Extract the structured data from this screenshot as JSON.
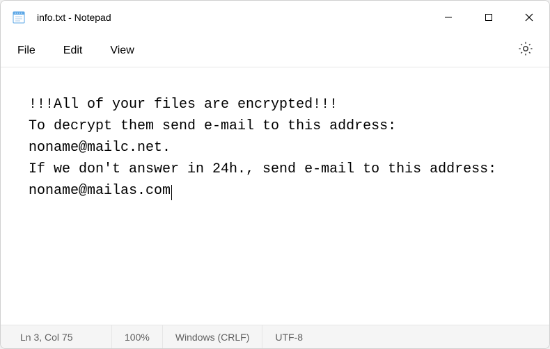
{
  "titlebar": {
    "title": "info.txt - Notepad"
  },
  "menu": {
    "file": "File",
    "edit": "Edit",
    "view": "View"
  },
  "editor": {
    "content": "!!!All of your files are encrypted!!!\nTo decrypt them send e-mail to this address: noname@mailc.net.\nIf we don't answer in 24h., send e-mail to this address: noname@mailas.com"
  },
  "statusbar": {
    "position": "Ln 3, Col 75",
    "zoom": "100%",
    "line_ending": "Windows (CRLF)",
    "encoding": "UTF-8"
  }
}
